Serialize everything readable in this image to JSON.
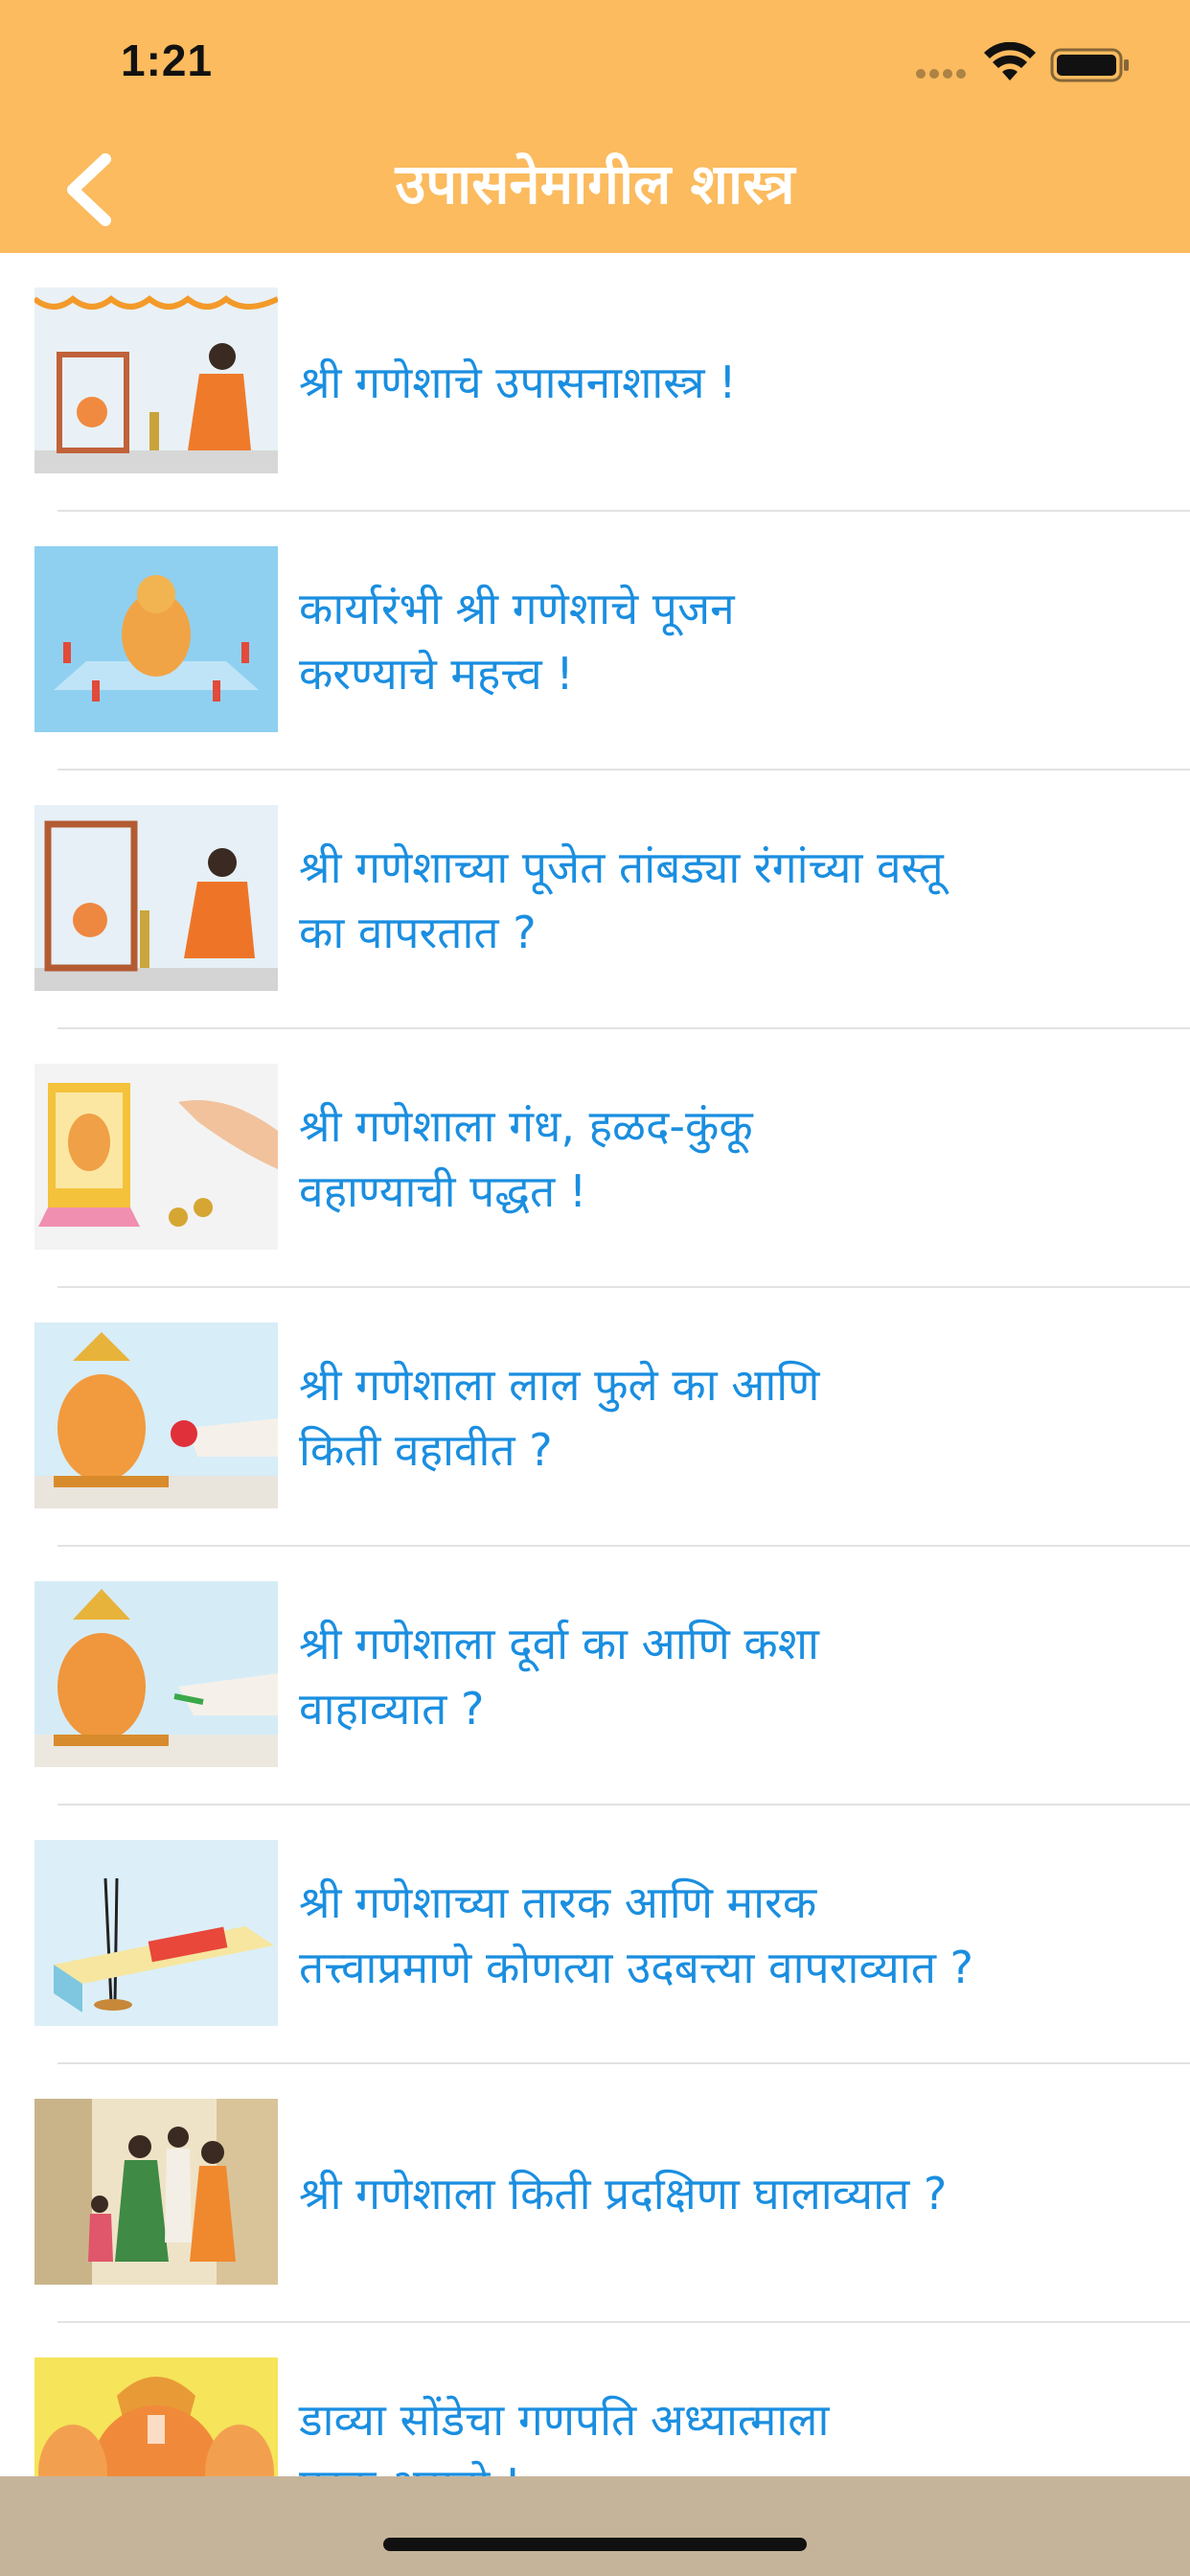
{
  "status_bar": {
    "time": "1:21"
  },
  "nav": {
    "title": "उपासनेमागील शास्त्र"
  },
  "items": [
    {
      "lines": [
        "श्री गणेशाचे उपासनाशास्त्र !"
      ]
    },
    {
      "lines": [
        "कार्यारंभी श्री गणेशाचे पूजन",
        "करण्याचे महत्त्व !"
      ]
    },
    {
      "lines": [
        "श्री गणेशाच्या पूजेत तांबड्या रंगांच्या वस्तू",
        "का वापरतात ?"
      ]
    },
    {
      "lines": [
        "श्री गणेशाला गंध, हळद-कुंकू",
        "वहाण्याची पद्धत !"
      ]
    },
    {
      "lines": [
        "श्री गणेशाला लाल फुले का आणि",
        "किती वहावीत ?"
      ]
    },
    {
      "lines": [
        "श्री गणेशाला दूर्वा का आणि कशा",
        "वाहाव्यात ?"
      ]
    },
    {
      "lines": [
        "श्री गणेशाच्या तारक आणि मारक",
        "तत्त्वाप्रमाणे कोणत्या उदबत्त्या वापराव्यात ?"
      ]
    },
    {
      "lines": [
        "श्री गणेशाला किती प्रदक्षिणा घालाव्यात ?"
      ]
    },
    {
      "lines": [
        "डाव्या सोंडेचा गणपति अध्यात्माला",
        "पूरक असतो !"
      ]
    }
  ],
  "colors": {
    "header": "#fbbb5e",
    "link_text": "#1a8ee0",
    "divider": "#e2e2e2"
  },
  "icons": {
    "back": "chevron-left-icon",
    "signal": "cellular-signal-icon",
    "wifi": "wifi-icon",
    "battery": "battery-icon"
  }
}
